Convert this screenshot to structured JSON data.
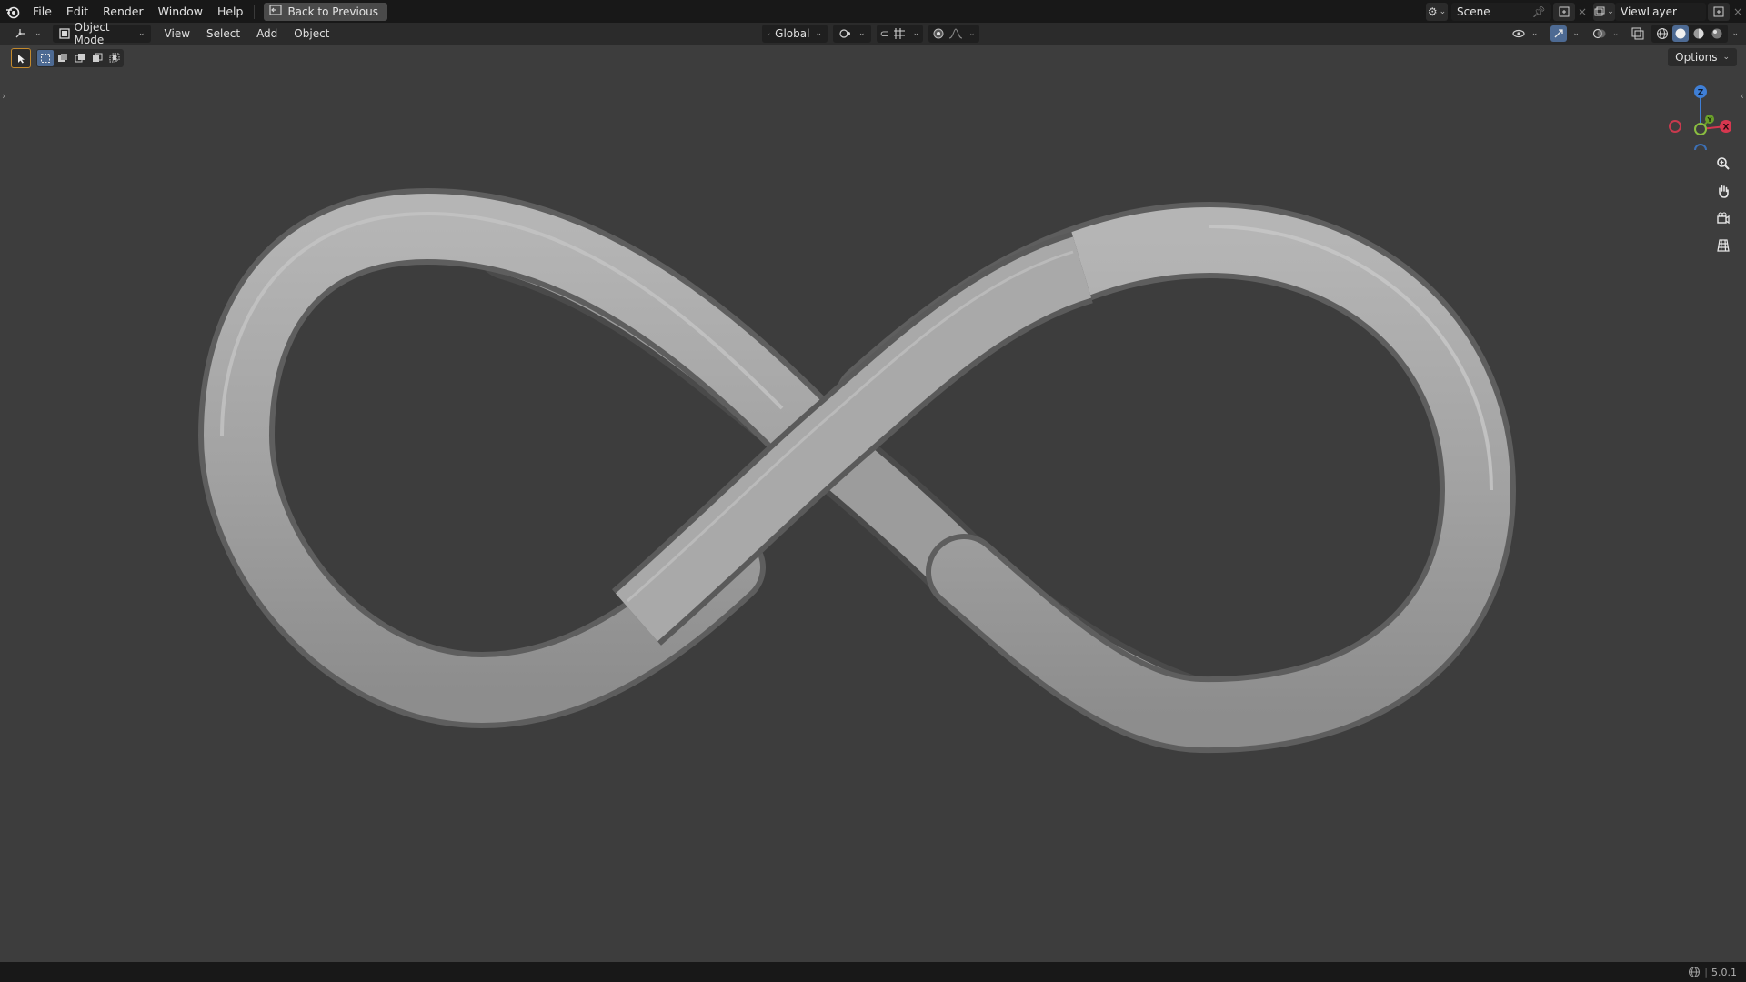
{
  "topbar": {
    "menus": [
      "File",
      "Edit",
      "Render",
      "Window",
      "Help"
    ],
    "back_label": "Back to Previous",
    "scene_name": "Scene",
    "view_layer_name": "ViewLayer"
  },
  "header": {
    "mode_label": "Object Mode",
    "menus": [
      "View",
      "Select",
      "Add",
      "Object"
    ],
    "orientation_label": "Global"
  },
  "viewport": {
    "options_label": "Options",
    "gizmo_axes": {
      "x": "X",
      "y": "Y",
      "z": "Z"
    },
    "background_color": "#3d3d3d",
    "model_color": "#a8a8a8"
  },
  "statusbar": {
    "version": "5.0.1"
  },
  "icons": {
    "logo": "blender-logo-icon",
    "editor_type": "3d-viewport-icon",
    "zoom": "zoom-icon",
    "pan": "hand-icon",
    "camera": "camera-icon",
    "grid": "grid-icon"
  }
}
